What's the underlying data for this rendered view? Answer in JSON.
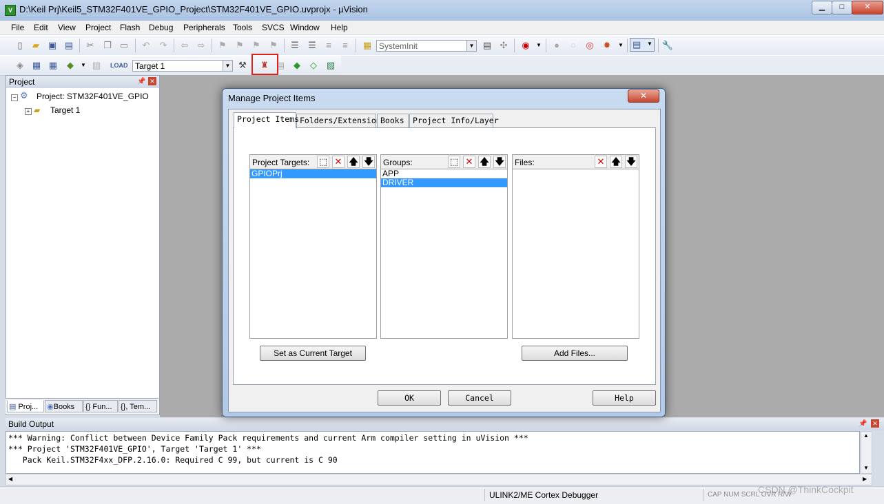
{
  "window": {
    "title": "D:\\Keil Prj\\Keil5_STM32F401VE_GPIO_Project\\STM32F401VE_GPIO.uvprojx - µVision",
    "icon": "uv-icon",
    "min_glyph": "▁",
    "max_glyph": "□",
    "close_glyph": "✕"
  },
  "menu": [
    "File",
    "Edit",
    "View",
    "Project",
    "Flash",
    "Debug",
    "Peripherals",
    "Tools",
    "SVCS",
    "Window",
    "Help"
  ],
  "toolbar1": {
    "function_combo": "SystemInit"
  },
  "toolbar2": {
    "target_combo": "Target 1"
  },
  "project_pane": {
    "header": "Project",
    "pin_glyph": "ᚱ",
    "close_glyph": "✕",
    "root_label": "Project: STM32F401VE_GPIO",
    "child_label": "Target 1",
    "tabs": [
      "Proj...",
      "Books",
      "{} Fun...",
      "{}, Tem..."
    ]
  },
  "build_output": {
    "header": "Build Output",
    "lines": [
      "*** Warning: Conflict between Device Family Pack requirements and current Arm compiler setting in uVision ***",
      "*** Project 'STM32F401VE_GPIO', Target 'Target 1' ***",
      "   Pack Keil.STM32F4xx_DFP.2.16.0: Required C 99, but current is C 90"
    ]
  },
  "status_bar": {
    "debugger": "ULINK2/ME Cortex Debugger",
    "indicators": "CAP  NUM  SCRL  OVR  R/W"
  },
  "watermark": "CSDN @ThinkCockpit",
  "dialog": {
    "title": "Manage Project Items",
    "close_glyph": "✕",
    "tabs": [
      "Project Items",
      "Folders/Extensions",
      "Books",
      "Project Info/Layer"
    ],
    "targets": {
      "label": "Project Targets:",
      "items": [
        "GPIOPrj"
      ],
      "selected": 0
    },
    "groups": {
      "label": "Groups:",
      "items": [
        "APP",
        "DRIVER"
      ],
      "selected": 1
    },
    "files": {
      "label": "Files:",
      "items": []
    },
    "set_current_label": "Set as Current Target",
    "add_files_label": "Add Files...",
    "ok_label": "OK",
    "cancel_label": "Cancel",
    "help_label": "Help",
    "btn_glyphs": {
      "new": "⬚",
      "delete": "✕",
      "up": "🡅",
      "down": "🡇"
    }
  }
}
